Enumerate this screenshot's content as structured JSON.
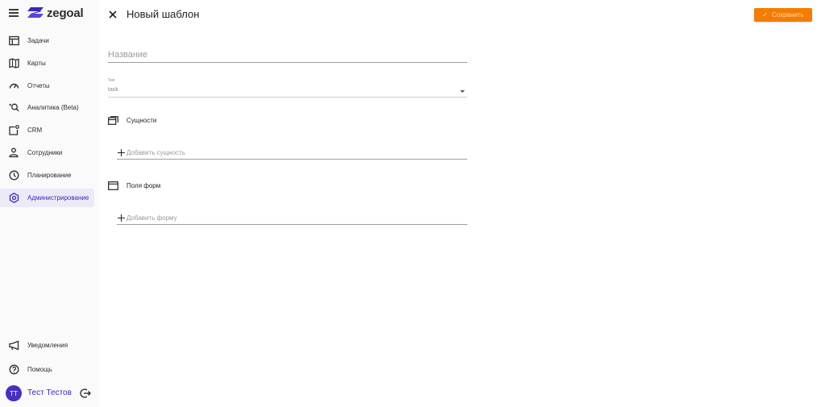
{
  "app": {
    "logo_text": "zegoal",
    "brand_color": "#3b2bb5",
    "accent_color": "#f57c00"
  },
  "sidebar": {
    "items": [
      {
        "label": "Задачи",
        "icon": "tasks-icon"
      },
      {
        "label": "Карты",
        "icon": "map-icon"
      },
      {
        "label": "Отчеты",
        "icon": "gauge-icon"
      },
      {
        "label": "Аналитика (Beta)",
        "icon": "analytics-search-icon"
      },
      {
        "label": "CRM",
        "icon": "crm-icon"
      },
      {
        "label": "Сотрудники",
        "icon": "employees-icon"
      },
      {
        "label": "Планирование",
        "icon": "clock-icon"
      },
      {
        "label": "Администрирование",
        "icon": "settings-icon",
        "active": true
      }
    ],
    "bottom": [
      {
        "label": "Уведомления",
        "icon": "megaphone-icon"
      },
      {
        "label": "Помощь",
        "icon": "help-icon"
      }
    ],
    "user": {
      "initials": "ТТ",
      "name": "Тест Тестов"
    }
  },
  "header": {
    "title": "Новый шаблон",
    "save_label": "Сохранить"
  },
  "form": {
    "name_placeholder": "Название",
    "type": {
      "label": "Тип",
      "value": "task"
    },
    "entities": {
      "title": "Сущности",
      "add_placeholder": "Добавить сущность"
    },
    "forms": {
      "title": "Поля форм",
      "add_placeholder": "Добавить форму"
    }
  }
}
